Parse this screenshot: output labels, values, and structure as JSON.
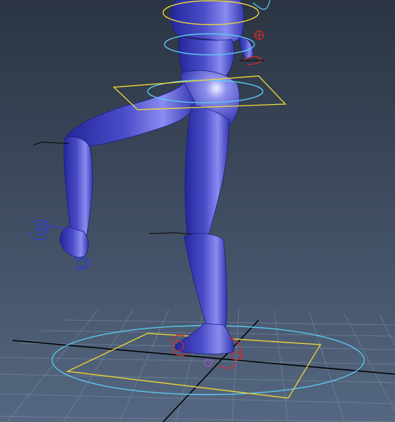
{
  "viewport": {
    "view": "perspective",
    "background_top": "#2b3442",
    "background_bottom": "#556781"
  },
  "scene": {
    "ground_grid": {
      "visible": true,
      "color": "#7f8fa6"
    },
    "axis_lines": {
      "color": "#000000"
    },
    "character": {
      "pose": "standing-on-left-leg-right-knee-raised",
      "color": "#4b4dc8"
    },
    "controls": {
      "root_circle_color": "#5cc8f0",
      "root_square_color": "#e8d23a",
      "hip_square_color": "#e8d23a",
      "hip_circle_color": "#5cc8f0",
      "chest_circle_color": "#5cc8f0",
      "neck_circle_color": "#e8d23a",
      "left_foot_ik_color": "#e0282a",
      "right_foot_ik_color": "#2a3ae0",
      "wrist_ik_color": "#e0282a"
    }
  }
}
